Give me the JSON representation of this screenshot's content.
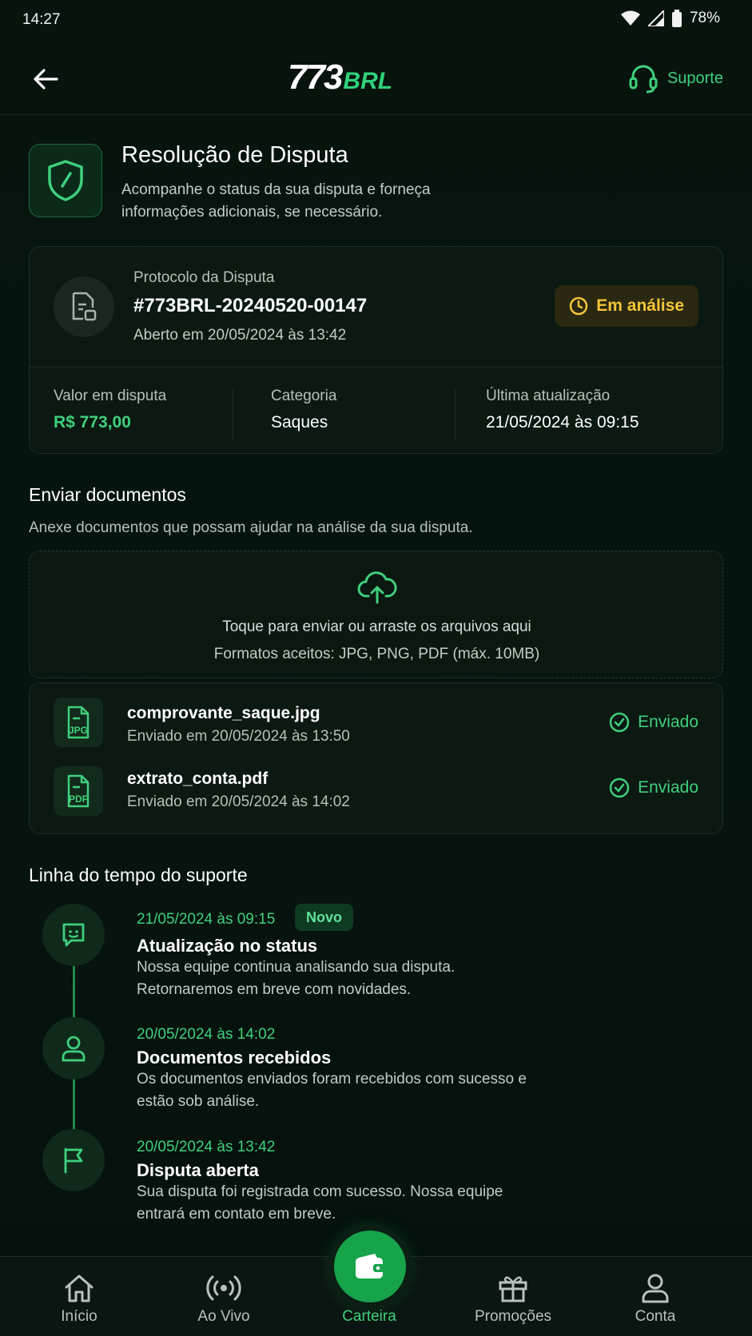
{
  "status_bar": {
    "time": "14:27",
    "battery": "78%"
  },
  "header": {
    "logo_number": "773",
    "logo_suffix": "BRL",
    "support_label": "Suporte"
  },
  "page": {
    "title": "Resolução de Disputa",
    "description": "Acompanhe o status da sua disputa e forneça informações adicionais, se necessário."
  },
  "dispute": {
    "protocol_label": "Protocolo da Disputa",
    "protocol_id": "#773BRL-20240520-00147",
    "opened": "Aberto em 20/05/2024 às 13:42",
    "status": "Em análise",
    "value_label": "Valor em disputa",
    "value": "R$ 773,00",
    "category_label": "Categoria",
    "category": "Saques",
    "last_update_label": "Última atualização",
    "last_update": "21/05/2024 às 09:15"
  },
  "upload": {
    "title": "Enviar documentos",
    "subtitle": "Anexe documentos que possam ajudar na análise da sua disputa.",
    "dropzone_text": "Toque para enviar ou arraste os arquivos aqui",
    "formats": "Formatos aceitos: JPG, PNG, PDF (máx. 10MB)"
  },
  "files": [
    {
      "name": "comprovante_saque.jpg",
      "type": "JPG",
      "date": "Enviado em 20/05/2024 às 13:50",
      "status": "Enviado"
    },
    {
      "name": "extrato_conta.pdf",
      "type": "PDF",
      "date": "Enviado em 20/05/2024 às 14:02",
      "status": "Enviado"
    }
  ],
  "timeline": {
    "title": "Linha do tempo do suporte",
    "new_badge": "Novo",
    "events": [
      {
        "icon": "chat-bubble-icon",
        "date": "21/05/2024 às 09:15",
        "title": "Atualização no status",
        "body": "Nossa equipe continua analisando sua disputa. Retornaremos em breve com novidades."
      },
      {
        "icon": "user-icon",
        "date": "20/05/2024 às 14:02",
        "title": "Documentos recebidos",
        "body": "Os documentos enviados foram recebidos com sucesso e estão sob análise."
      },
      {
        "icon": "flag-icon",
        "date": "20/05/2024 às 13:42",
        "title": "Disputa aberta",
        "body": "Sua disputa foi registrada com sucesso. Nossa equipe entrará em contato em breve."
      }
    ]
  },
  "nav": {
    "home": "Início",
    "live": "Ao Vivo",
    "wallet": "Carteira",
    "promos": "Promoções",
    "account": "Conta"
  },
  "colors": {
    "accent": "#3fd07c",
    "warning": "#f4c43a",
    "background": "#06120c"
  }
}
